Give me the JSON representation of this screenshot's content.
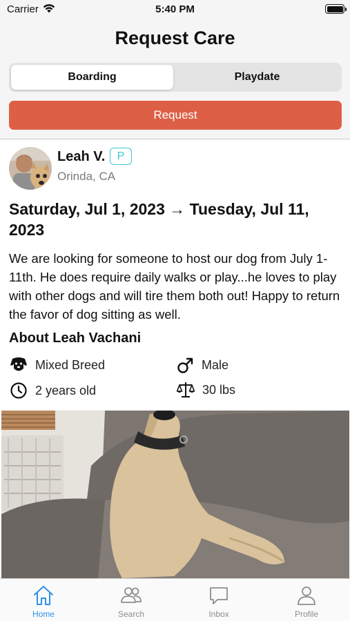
{
  "status": {
    "carrier": "Carrier",
    "time": "5:40 PM"
  },
  "header": {
    "title": "Request Care"
  },
  "segment": {
    "options": [
      "Boarding",
      "Playdate"
    ],
    "selected": "Boarding"
  },
  "request_button": "Request",
  "owner": {
    "name": "Leah V.",
    "badge": "P",
    "location": "Orinda, CA"
  },
  "listing": {
    "dates": "Saturday, Jul 1, 2023 → Tuesday, Jul 11, 2023",
    "description": "We are looking for someone to host our dog from July 1-11th. He does require daily walks or play...he loves to play with other dogs and will tire them both out! Happy to return the favor of dog sitting as well."
  },
  "about": {
    "heading": "About Leah Vachani",
    "breed": "Mixed Breed",
    "gender": "Male",
    "age": "2 years old",
    "weight": "30 lbs"
  },
  "tabs": [
    {
      "label": "Home",
      "icon": "home-icon",
      "active": true
    },
    {
      "label": "Search",
      "icon": "people-icon",
      "active": false
    },
    {
      "label": "Inbox",
      "icon": "chat-bubble-icon",
      "active": false
    },
    {
      "label": "Profile",
      "icon": "person-icon",
      "active": false
    }
  ],
  "colors": {
    "accent": "#dd6046",
    "badge": "#3cc7d6",
    "tab_active": "#2f8fea"
  }
}
